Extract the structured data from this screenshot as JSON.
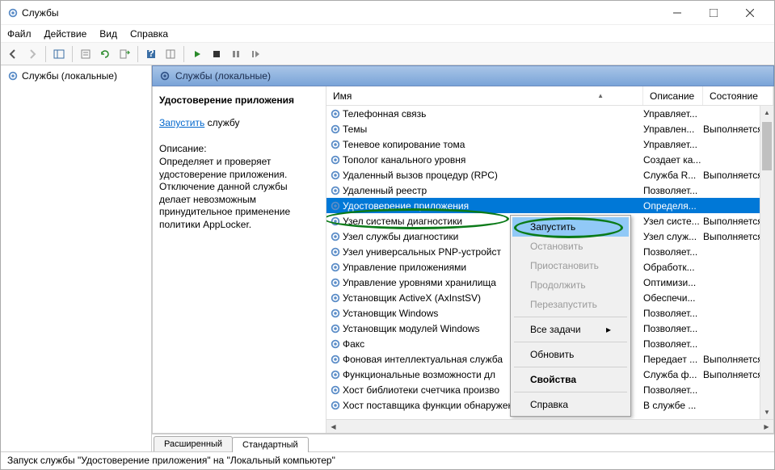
{
  "window": {
    "title": "Службы"
  },
  "menu": {
    "file": "Файл",
    "action": "Действие",
    "view": "Вид",
    "help": "Справка"
  },
  "tree": {
    "root": "Службы (локальные)"
  },
  "panel": {
    "title": "Службы (локальные)"
  },
  "detail": {
    "service_name": "Удостоверение приложения",
    "start_link": "Запустить",
    "start_suffix": " службу",
    "desc_label": "Описание:",
    "desc_text": "Определяет и проверяет удостоверение приложения. Отключение данной службы делает невозможным принудительное применение политики AppLocker."
  },
  "columns": {
    "name": "Имя",
    "desc": "Описание",
    "state": "Состояние"
  },
  "services": [
    {
      "name": "Телефонная связь",
      "desc": "Управляет...",
      "state": ""
    },
    {
      "name": "Темы",
      "desc": "Управлен...",
      "state": "Выполняется"
    },
    {
      "name": "Теневое копирование тома",
      "desc": "Управляет...",
      "state": ""
    },
    {
      "name": "Тополог канального уровня",
      "desc": "Создает ка...",
      "state": ""
    },
    {
      "name": "Удаленный вызов процедур (RPC)",
      "desc": "Служба R...",
      "state": "Выполняется"
    },
    {
      "name": "Удаленный реестр",
      "desc": "Позволяет...",
      "state": ""
    },
    {
      "name": "Удостоверение приложения",
      "desc": "Определя...",
      "state": "",
      "selected": true
    },
    {
      "name": "Узел системы диагностики",
      "desc": "Узел систе...",
      "state": "Выполняется"
    },
    {
      "name": "Узел службы диагностики",
      "desc": "Узел служ...",
      "state": "Выполняется"
    },
    {
      "name": "Узел универсальных PNP-устройст",
      "desc": "Позволяет...",
      "state": ""
    },
    {
      "name": "Управление приложениями",
      "desc": "Обработк...",
      "state": ""
    },
    {
      "name": "Управление уровнями хранилища",
      "desc": "Оптимизи...",
      "state": ""
    },
    {
      "name": "Установщик ActiveX (AxInstSV)",
      "desc": "Обеспечи...",
      "state": ""
    },
    {
      "name": "Установщик Windows",
      "desc": "Позволяет...",
      "state": ""
    },
    {
      "name": "Установщик модулей Windows",
      "desc": "Позволяет...",
      "state": ""
    },
    {
      "name": "Факс",
      "desc": "Позволяет...",
      "state": ""
    },
    {
      "name": "Фоновая интеллектуальная служба",
      "desc": "Передает ...",
      "state": "Выполняется"
    },
    {
      "name": "Функциональные возможности дл",
      "desc": "Служба ф...",
      "state": "Выполняется"
    },
    {
      "name": "Хост библиотеки счетчика произво",
      "desc": "Позволяет...",
      "state": ""
    },
    {
      "name": "Хост поставщика функции обнаружения",
      "desc": "В службе ...",
      "state": ""
    }
  ],
  "context": {
    "start": "Запустить",
    "stop": "Остановить",
    "pause": "Приостановить",
    "resume": "Продолжить",
    "restart": "Перезапустить",
    "alltasks": "Все задачи",
    "refresh": "Обновить",
    "props": "Свойства",
    "help": "Справка"
  },
  "tabs": {
    "extended": "Расширенный",
    "standard": "Стандартный"
  },
  "status": "Запуск службы \"Удостоверение приложения\" на \"Локальный компьютер\""
}
